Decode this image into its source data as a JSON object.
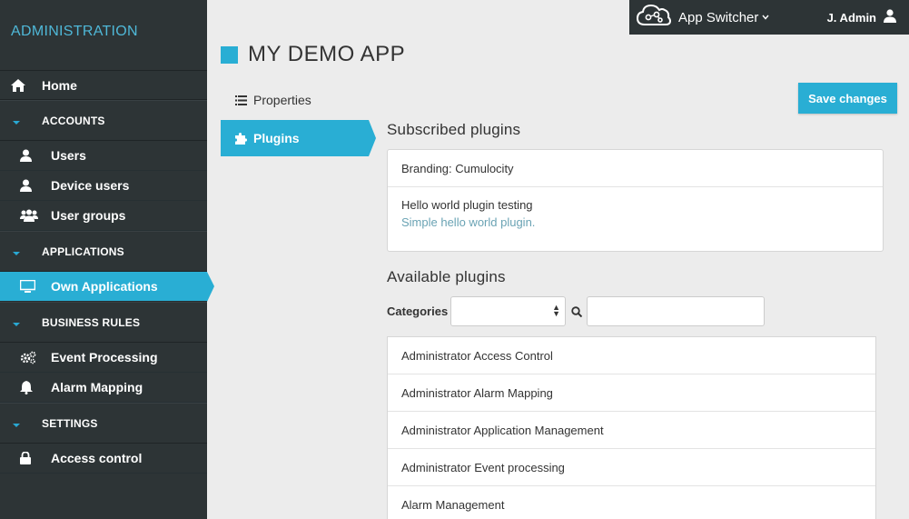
{
  "sidebar": {
    "brand": "ADMINISTRATION",
    "home": "Home",
    "sections": {
      "accounts": "ACCOUNTS",
      "applications": "APPLICATIONS",
      "business_rules": "BUSINESS RULES",
      "settings": "SETTINGS"
    },
    "items": {
      "users": "Users",
      "device_users": "Device users",
      "user_groups": "User groups",
      "own_applications": "Own Applications",
      "event_processing": "Event Processing",
      "alarm_mapping": "Alarm Mapping",
      "access_control": "Access control"
    },
    "accent": "#29aed4"
  },
  "topbar": {
    "app_switcher": "App Switcher",
    "user": "J. Admin"
  },
  "page": {
    "title": "MY DEMO APP"
  },
  "subnav": {
    "properties": "Properties",
    "plugins": "Plugins"
  },
  "actions": {
    "save": "Save changes"
  },
  "subscribed": {
    "title": "Subscribed plugins",
    "items": [
      {
        "name": "Branding: Cumulocity",
        "description": ""
      },
      {
        "name": "Hello world plugin testing",
        "description": "Simple hello world plugin."
      }
    ]
  },
  "available": {
    "title": "Available plugins",
    "categories_label": "Categories",
    "categories_value": "",
    "search_value": "",
    "items": [
      "Administrator Access Control",
      "Administrator Alarm Mapping",
      "Administrator Application Management",
      "Administrator Event processing",
      "Alarm Management"
    ]
  }
}
